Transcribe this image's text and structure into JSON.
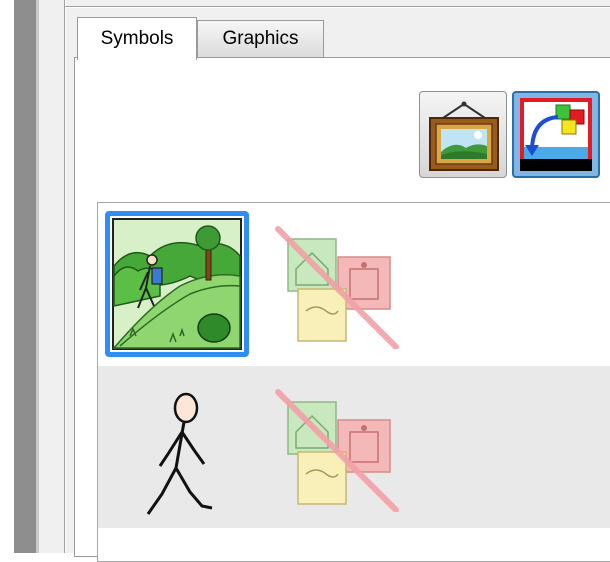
{
  "tabs": [
    {
      "label": "Symbols",
      "selected": true
    },
    {
      "label": "Graphics",
      "selected": false
    }
  ],
  "toolbar": {
    "picture_button_icon": "framed-picture-icon",
    "swap_button_icon": "swap-graphics-icon",
    "swap_button_pressed": true
  },
  "symbols_list": [
    {
      "image": "hiking-symbol-picture",
      "graphic": "no-graphic-icon",
      "selected": true
    },
    {
      "image": "walking-stick-figure-symbol",
      "graphic": "no-graphic-icon",
      "selected": false
    }
  ],
  "colors": {
    "selection_blue": "#2e8ef2",
    "no_graphic_strike": "#f2a0a8",
    "pressed_button": "#7fb6e6"
  }
}
